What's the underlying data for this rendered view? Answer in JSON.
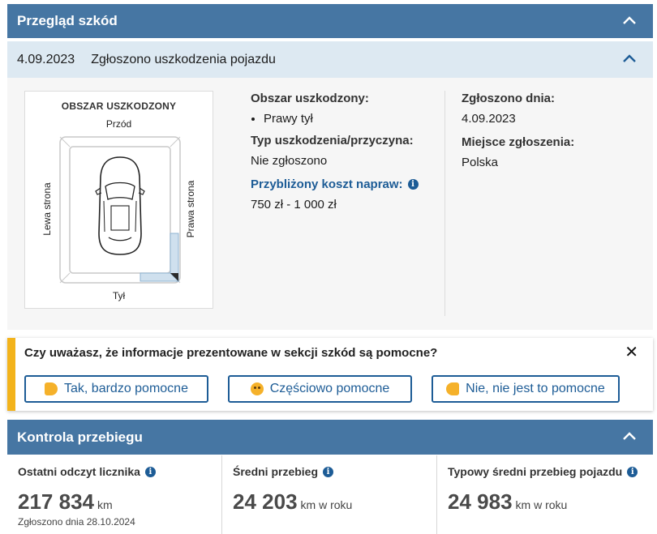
{
  "damage_section": {
    "title": "Przegląd szkód",
    "entry": {
      "date": "4.09.2023",
      "title": "Zgłoszono uszkodzenia pojazdu"
    },
    "diagram": {
      "title": "OBSZAR USZKODZONY",
      "front": "Przód",
      "rear": "Tył",
      "left": "Lewa strona",
      "right": "Prawa strona"
    },
    "area_label": "Obszar uszkodzony:",
    "areas": [
      "Prawy tył"
    ],
    "type_label": "Typ uszkodzenia/przyczyna:",
    "type_value": "Nie zgłoszono",
    "cost_label": "Przybliżony koszt napraw:",
    "cost_value": "750 zł - 1 000 zł",
    "reported_label": "Zgłoszono dnia:",
    "reported_value": "4.09.2023",
    "place_label": "Miejsce zgłoszenia:",
    "place_value": "Polska"
  },
  "feedback": {
    "question": "Czy uważasz, że informacje prezentowane w sekcji szkód są pomocne?",
    "buttons": [
      "Tak, bardzo pomocne",
      "Częściowo pomocne",
      "Nie, nie jest to pomocne"
    ],
    "accent_color": "#f3b31b"
  },
  "mileage_section": {
    "title": "Kontrola przebiegu",
    "columns": [
      {
        "label": "Ostatni odczyt licznika",
        "value": "217 834",
        "unit": "km",
        "note": "Zgłoszono dnia 28.10.2024"
      },
      {
        "label": "Średni przebieg",
        "value": "24 203",
        "unit": "km w roku"
      },
      {
        "label": "Typowy średni przebieg pojazdu",
        "value": "24 983",
        "unit": "km w roku"
      }
    ]
  },
  "colors": {
    "header": "#4676a3",
    "subheader": "#dde9f2",
    "link_blue": "#1d5c96"
  },
  "icons": [
    "chevron-up-icon",
    "info-icon",
    "close-icon",
    "thumbs-up-icon",
    "smiley-icon",
    "thumbs-down-icon"
  ]
}
